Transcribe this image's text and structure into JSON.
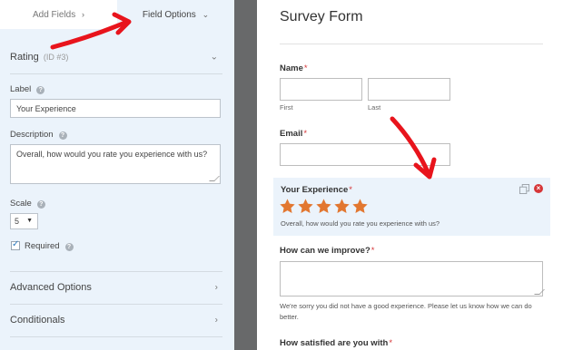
{
  "tabs": {
    "add_fields": "Add Fields",
    "add_fields_icon": "chevron-right-icon",
    "field_options": "Field Options",
    "field_options_icon": "chevron-down-icon"
  },
  "field_header": {
    "title": "Rating",
    "id": "(ID #3)",
    "toggle_icon": "chevron-down-icon"
  },
  "label_field": {
    "label": "Label",
    "value": "Your Experience"
  },
  "description_field": {
    "label": "Description",
    "value": "Overall, how would you rate you experience with us?"
  },
  "scale_field": {
    "label": "Scale",
    "selected": "5"
  },
  "required_field": {
    "label": "Required",
    "checked": true
  },
  "sections": {
    "advanced": "Advanced Options",
    "conditionals": "Conditionals"
  },
  "colors": {
    "panel_bg": "#ebf3fb",
    "gutter": "#68696a",
    "star": "#e27730",
    "required_marker": "#d63638",
    "annotation_arrow": "#e8141c"
  },
  "form": {
    "title": "Survey Form",
    "name": {
      "label": "Name",
      "required_mark": "*",
      "first": "First",
      "last": "Last"
    },
    "email": {
      "label": "Email",
      "required_mark": "*"
    },
    "rating": {
      "label": "Your Experience",
      "required_mark": "*",
      "stars": 5,
      "description": "Overall, how would you rate you experience with us?"
    },
    "improve": {
      "label": "How can we improve?",
      "required_mark": "*",
      "help": "We're sorry you did not have a good experience. Please let us know how we can do better."
    },
    "satisfied": {
      "label": "How satisfied are you with",
      "required_mark": "*"
    }
  }
}
